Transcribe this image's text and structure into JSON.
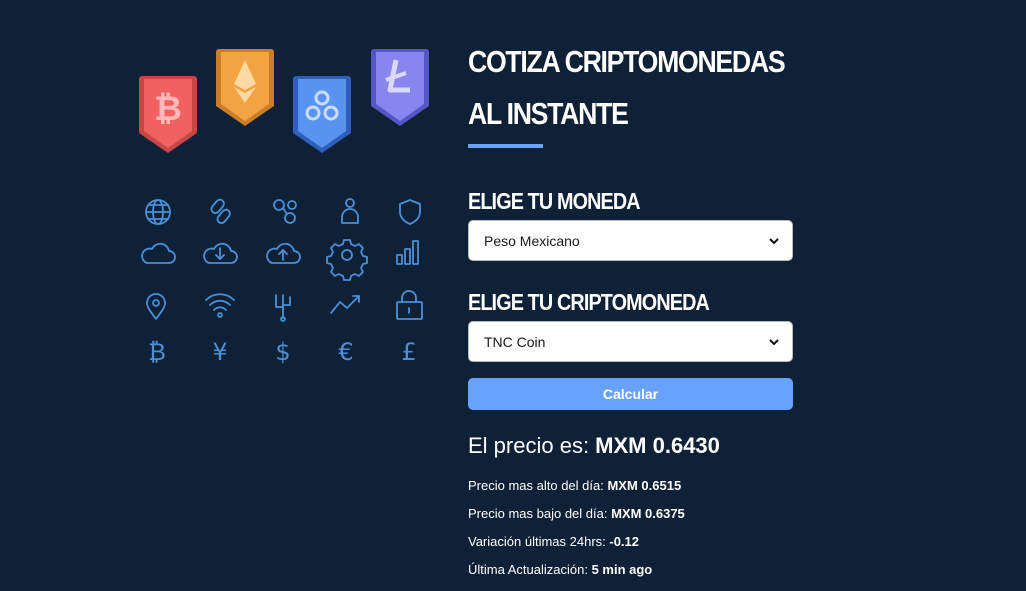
{
  "header": {
    "title": "COTIZA CRIPTOMONEDAS AL INSTANTE"
  },
  "form": {
    "currency_label": "ELIGE TU MONEDA",
    "currency_selected": "Peso Mexicano",
    "crypto_label": "ELIGE TU CRIPTOMONEDA",
    "crypto_selected": "TNC Coin",
    "submit_label": "Calcular"
  },
  "result": {
    "price_label": "El precio es: ",
    "price_value": "MXM 0.6430",
    "high_label": "Precio mas alto del día: ",
    "high_value": "MXM 0.6515",
    "low_label": "Precio mas bajo del día: ",
    "low_value": "MXM 0.6375",
    "change_label": "Variación últimas 24hrs: ",
    "change_value": "-0.12",
    "updated_label": "Última Actualización: ",
    "updated_value": "5 min ago"
  },
  "colors": {
    "background": "#0e2136",
    "accent": "#66a2fe",
    "icon_stroke": "#4a90d9",
    "bitcoin_badge": "#f06161",
    "ethereum_badge": "#f4a342",
    "ripple_badge": "#5a93f0",
    "litecoin_badge": "#8686ee"
  },
  "icons": {
    "badges": [
      "bitcoin-icon",
      "ethereum-icon",
      "ripple-icon",
      "litecoin-icon"
    ],
    "grid": [
      "globe-icon",
      "link-icon",
      "nodes-icon",
      "user-icon",
      "shield-icon",
      "cloud-icon",
      "cloud-download-icon",
      "cloud-upload-icon",
      "gear-icon",
      "bar-chart-icon",
      "location-pin-icon",
      "wifi-icon",
      "circuit-icon",
      "trend-up-icon",
      "lock-icon",
      "bitcoin-symbol-icon",
      "yen-icon",
      "dollar-icon",
      "euro-icon",
      "pound-icon"
    ]
  }
}
